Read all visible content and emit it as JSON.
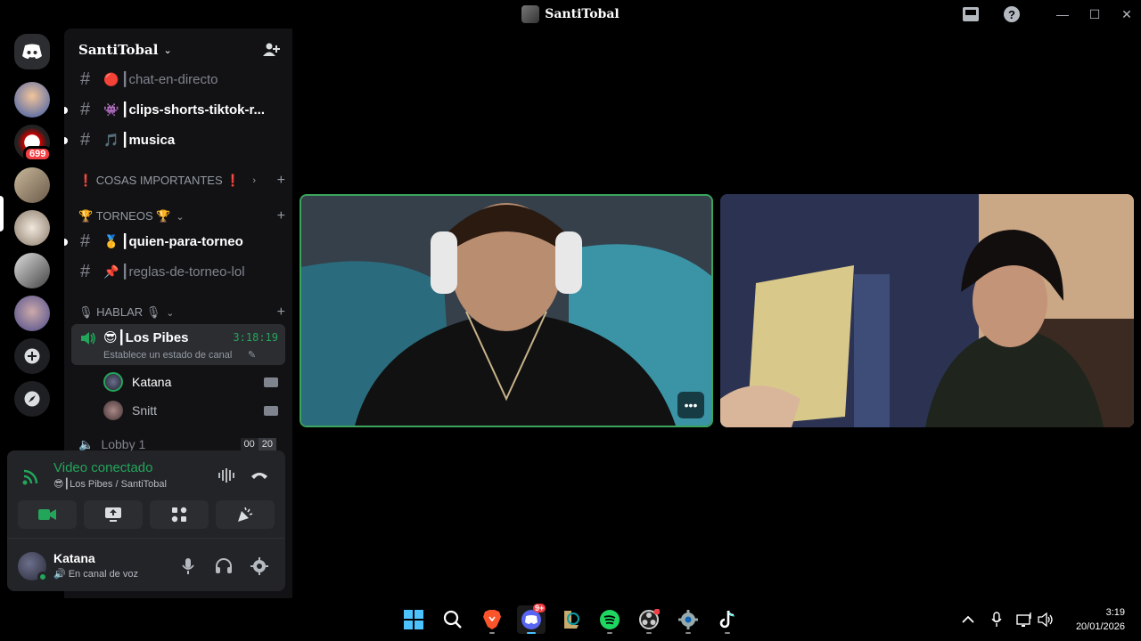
{
  "window": {
    "title": "SantiTobal"
  },
  "servers": {
    "badge": "699"
  },
  "guild": {
    "name": "SantiTobal"
  },
  "channels": [
    {
      "emoji": "🔴",
      "label": "┃chat-en-directo",
      "unread": false
    },
    {
      "emoji": "👾",
      "label": "┃clips-shorts-tiktok-r...",
      "unread": true
    },
    {
      "emoji": "🎵",
      "label": "┃musica",
      "unread": true
    }
  ],
  "categories": {
    "important": "❗ COSAS IMPORTANTES ❗",
    "torneos": "🏆 TORNEOS 🏆",
    "hablar": "🎙 HABLAR 🎙"
  },
  "torneo_channels": [
    {
      "emoji": "🥇",
      "label": "┃quien-para-torneo",
      "unread": true
    },
    {
      "emoji": "📌",
      "label": "┃reglas-de-torneo-lol",
      "unread": false
    }
  ],
  "voice": {
    "channel": "😎┃Los Pibes",
    "timer": "3:18:19",
    "status_placeholder": "Establece un estado de canal",
    "members": [
      "Katana",
      "Snitt"
    ],
    "next_channel": "Lobby 1",
    "next_counts": [
      "00",
      "20"
    ]
  },
  "connection": {
    "title": "Video conectado",
    "sub": "😎┃Los Pibes / SantiTobal"
  },
  "user": {
    "name": "Katana",
    "status": "En canal de voz"
  },
  "taskbar": {
    "discord_badge": "9+",
    "time": "3:19",
    "date": "20/01/2026"
  },
  "colors": {
    "accent_green": "#23a55a",
    "tile_border": "#3ba55c",
    "badge_red": "#f23f43"
  }
}
